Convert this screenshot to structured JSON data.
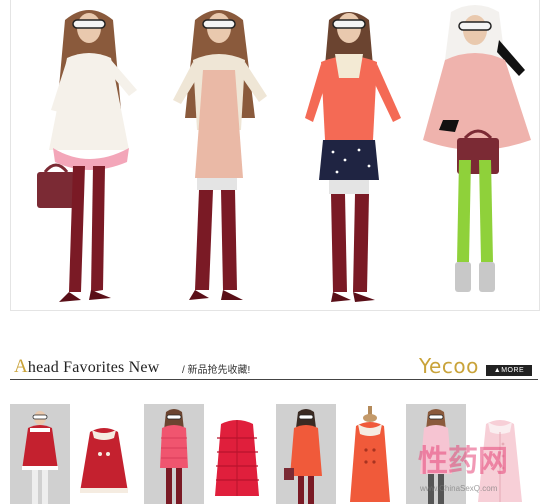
{
  "section": {
    "title_cap": "A",
    "title_rest": "head Favorites New",
    "subtitle": "/ 新品抢先收藏!",
    "brand": "Yecoo",
    "more": "▲MORE"
  },
  "watermark": {
    "text": "性药网",
    "url": "www.ChinaSexQ.com"
  },
  "colors": {
    "accent_gold": "#c9a33a",
    "stocking_red": "#7a1a25",
    "coat_red": "#c4212f",
    "coral": "#f46a55"
  },
  "hero_models": [
    {
      "outfit": "white coat with pink skirt and red stockings",
      "bag": "burgundy handbag"
    },
    {
      "outfit": "cream knit cardigan with pink dress",
      "bag": ""
    },
    {
      "outfit": "coral sweater with navy polka-dot skirt",
      "bag": ""
    },
    {
      "outfit": "pink cape with white fur hood and green leggings",
      "bag": "burgundy handbag"
    }
  ],
  "thumbnails": [
    {
      "kind": "model",
      "garment": "red fur-trim coat"
    },
    {
      "kind": "product",
      "garment": "red fur-trim coat"
    },
    {
      "kind": "model",
      "garment": "pink puffer jacket"
    },
    {
      "kind": "product",
      "garment": "red puffer jacket"
    },
    {
      "kind": "model",
      "garment": "coral trench coat"
    },
    {
      "kind": "product",
      "garment": "coral trench coat"
    },
    {
      "kind": "model",
      "garment": "light pink coat"
    },
    {
      "kind": "product",
      "garment": "light pink coat"
    }
  ]
}
